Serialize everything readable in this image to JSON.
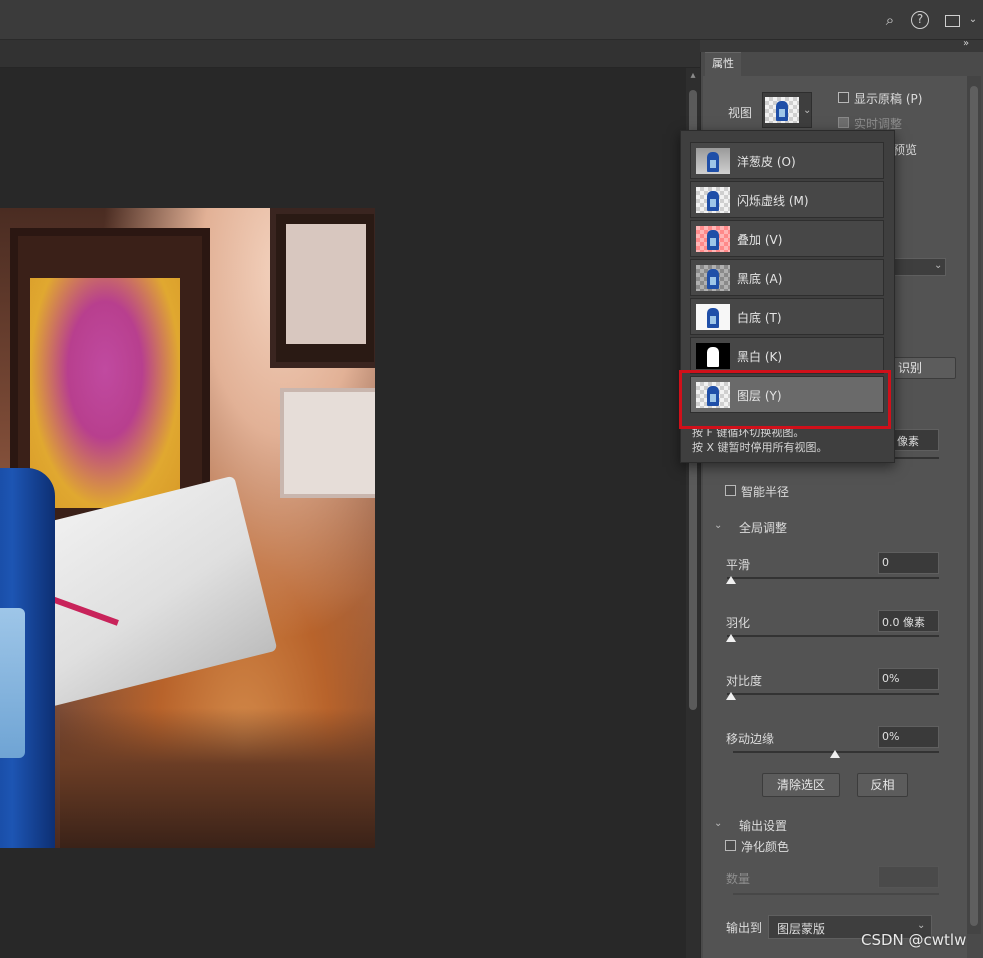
{
  "topbar": {
    "search_icon": "search-icon",
    "help_icon": "help-icon",
    "workspace_icon": "workspace-icon"
  },
  "panel": {
    "tab_label": "属性",
    "view_label": "视图",
    "show_original_label": "显示原稿 (P)",
    "realtime_label": "实时调整",
    "preview_partial": "预览",
    "identify_partial": "识别",
    "pixel_partial": "像素",
    "smart_radius_label": "智能半径",
    "global_adjust_label": "全局调整",
    "smooth_label": "平滑",
    "smooth_value": "0",
    "feather_label": "羽化",
    "feather_value": "0.0 像素",
    "contrast_label": "对比度",
    "contrast_value": "0%",
    "shift_edge_label": "移动边缘",
    "shift_edge_value": "0%",
    "clear_selection_label": "清除选区",
    "invert_label": "反相",
    "output_settings_label": "输出设置",
    "decontaminate_label": "净化颜色",
    "amount_label": "数量",
    "output_to_label": "输出到",
    "output_to_value": "图层蒙版"
  },
  "view_popup": {
    "items": [
      {
        "label": "洋葱皮 (O)",
        "icon": "onion-skin-icon"
      },
      {
        "label": "闪烁虚线 (M)",
        "icon": "marching-ants-icon"
      },
      {
        "label": "叠加 (V)",
        "icon": "overlay-icon"
      },
      {
        "label": "黑底 (A)",
        "icon": "on-black-icon"
      },
      {
        "label": "白底 (T)",
        "icon": "on-white-icon"
      },
      {
        "label": "黑白 (K)",
        "icon": "black-white-icon"
      },
      {
        "label": "图层 (Y)",
        "icon": "on-layers-icon"
      }
    ],
    "selected": "图层 (Y)",
    "hint_line1": "按 F 键循环切换视图。",
    "hint_line2": "按 X 键暂时停用所有视图。"
  },
  "colors": {
    "highlight": "#d0101a",
    "panel_bg": "#535353",
    "canvas_bg": "#282828"
  },
  "slider_levels": {
    "smooth": 0,
    "feather": 0,
    "contrast": 0,
    "shift_edge": 0
  },
  "watermark": "CSDN @cwtlw"
}
